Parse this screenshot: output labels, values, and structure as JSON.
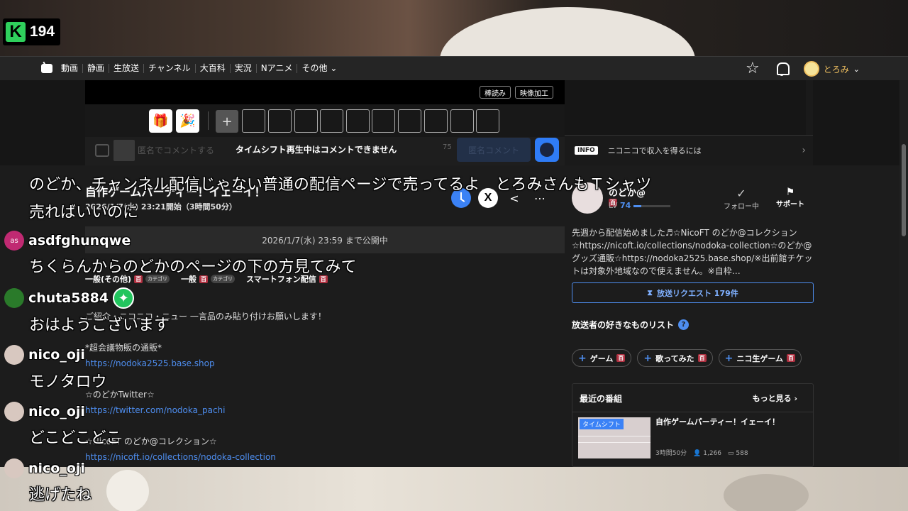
{
  "overlay_badge": {
    "logo": "K",
    "count": "194"
  },
  "nav": {
    "items": [
      "動画",
      "静画",
      "生放送",
      "チャンネル",
      "大百科",
      "実況",
      "Nアニメ",
      "その他"
    ],
    "more_chevron": "chevron-down-icon",
    "user_name": "とろみ"
  },
  "player": {
    "reading_btn": "棒読み",
    "video_btn": "映像加工"
  },
  "comment_bar": {
    "placeholder": "匿名でコメントする",
    "message": "タイムシフト再生中はコメントできません",
    "char_count": "75",
    "submit_label": "匿名コメント"
  },
  "ad_panel": {
    "info_tag": "INFO",
    "info_text": "ニコニコで収入を得るには"
  },
  "program": {
    "title": "自作ゲームパーティー！イェーイ！",
    "start_info": "2026/1/7(水) 23:21開始（3時間50分）",
    "publish_until": "2026/1/7(水) 23:59 まで公開中",
    "tags": [
      {
        "label": "一般(その他)",
        "dic": "百",
        "cat": "カテゴリ"
      },
      {
        "label": "一般",
        "dic": "百",
        "cat": "カテゴリ"
      },
      {
        "label": "スマートフォン配信",
        "dic": "百",
        "cat": ""
      }
    ],
    "desc_line1": "ご紹介・ニコニコ・ニュー 一言品のみ貼り付けお願いします！",
    "desc_shop_title": "*超会議物販の通販*",
    "desc_shop_url": "https://nodoka2525.base.shop",
    "desc_twitter_title": "☆のどかTwitter☆",
    "desc_twitter_url": "https://twitter.com/nodoka_pachi",
    "desc_nicoft_title": "☆NicoFT のどか@コレクション☆",
    "desc_nicoft_url": "https://nicoft.io/collections/nodoka-collection"
  },
  "broadcaster": {
    "name": "のどか@",
    "name_badge": "百",
    "level_label": "LV",
    "level": "74",
    "level_progress": 0.22,
    "follow_label": "フォロー中",
    "support_label": "サポート",
    "profile": "先週から配信始めました♬☆NicoFT のどか@コレクション☆https://nicoft.io/collections/nodoka-collection☆のどか@グッズ通販☆https://nodoka2525.base.shop/※出前館チケットは対象外地域なので使えません。※自枠…",
    "request_label": "放送リクエスト 179件",
    "fav_title": "放送者の好きなものリスト",
    "fav_items": [
      {
        "label": "ゲーム",
        "dic": "百"
      },
      {
        "label": "歌ってみた",
        "dic": "百"
      },
      {
        "label": "ニコ生ゲーム",
        "dic": "百"
      }
    ]
  },
  "recent": {
    "title": "最近の番組",
    "more": "もっと見る",
    "item_badge": "タイムシフト",
    "item_title": "自作ゲームパーティー！イェーイ！",
    "item_duration": "3時間50分",
    "item_views": "1,266",
    "item_comments": "588"
  },
  "overlay_comments": [
    {
      "user": "",
      "lines": [
        "のどか、チャンネル配信じゃない普通の配信ページで売ってるよ　とろみさんもＴシャツ",
        "売ればいいのに"
      ]
    },
    {
      "user": "asdfghunqwe",
      "avatar_text": "as",
      "avatar_color": "#c02a72",
      "lines": [
        "ちくらんからのどかのページの下の方見てみて"
      ]
    },
    {
      "user": "chuta5884",
      "avatar_color": "#2a7a2a",
      "lines": [
        "おはようございます"
      ]
    },
    {
      "user": "nico_oji",
      "avatar_color": "#d8c8c0",
      "lines": [
        "モノタロウ"
      ]
    },
    {
      "user": "nico_oji",
      "avatar_color": "#d8c8c0",
      "lines": [
        "どこどこどこ"
      ]
    },
    {
      "user": "nico_oji",
      "avatar_color": "#d8c8c0",
      "lines": [
        "逃げたね"
      ]
    }
  ]
}
